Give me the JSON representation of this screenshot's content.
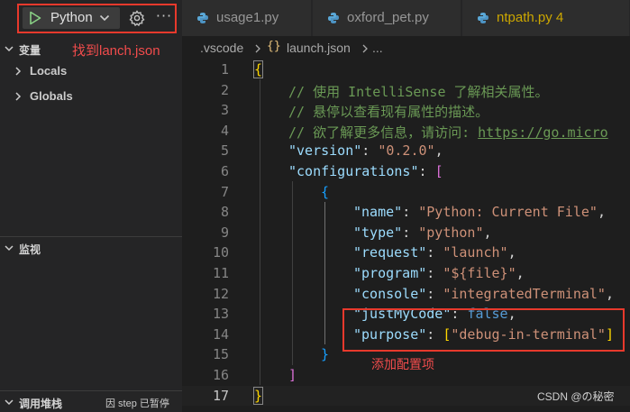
{
  "run_toolbar": {
    "config_name": "Python",
    "annotation": "找到lanch.json"
  },
  "sidebar": {
    "variables_title": "变量",
    "locals_label": "Locals",
    "globals_label": "Globals",
    "watch_title": "监视",
    "callstack_title": "调用堆栈",
    "paused_status": "因 step 已暂停"
  },
  "tabs": [
    {
      "label": "usage1.py"
    },
    {
      "label": "oxford_pet.py"
    },
    {
      "label": "ntpath.py 4"
    }
  ],
  "breadcrumb": {
    "folder": ".vscode",
    "file": "launch.json",
    "ellipsis": "..."
  },
  "editor": {
    "line_numbers": [
      "1",
      "2",
      "3",
      "4",
      "5",
      "6",
      "7",
      "8",
      "9",
      "10",
      "11",
      "12",
      "13",
      "14",
      "15",
      "16",
      "17"
    ],
    "l1_brace": "{",
    "l2_comment": "// 使用 IntelliSense 了解相关属性。",
    "l3_comment": "// 悬停以查看现有属性的描述。",
    "l4_comment_prefix": "// 欲了解更多信息，请访问: ",
    "l4_url": "https://go.micro",
    "l5_key": "\"version\"",
    "l5_value": "\"0.2.0\"",
    "l6_key": "\"configurations\"",
    "l6_bracket": "[",
    "l7_brace": "{",
    "l8_key": "\"name\"",
    "l8_value": "\"Python: Current File\"",
    "l9_key": "\"type\"",
    "l9_value": "\"python\"",
    "l10_key": "\"request\"",
    "l10_value": "\"launch\"",
    "l11_key": "\"program\"",
    "l11_value": "\"${file}\"",
    "l12_key": "\"console\"",
    "l12_value": "\"integratedTerminal\"",
    "l13_key": "\"justMyCode\"",
    "l13_value": "false",
    "l14_key": "\"purpose\"",
    "l14_value": "\"debug-in-terminal\"",
    "l15_brace": "}",
    "l16_bracket": "]",
    "l17_brace": "}",
    "annotation": "添加配置项"
  },
  "watermark": "CSDN @の秘密",
  "colors": {
    "annotation_red": "#e8392c",
    "string": "#ce9178",
    "key": "#9cdcfe",
    "comment": "#6a9955",
    "keyword": "#569cd6",
    "warning_tab": "#cca700"
  }
}
